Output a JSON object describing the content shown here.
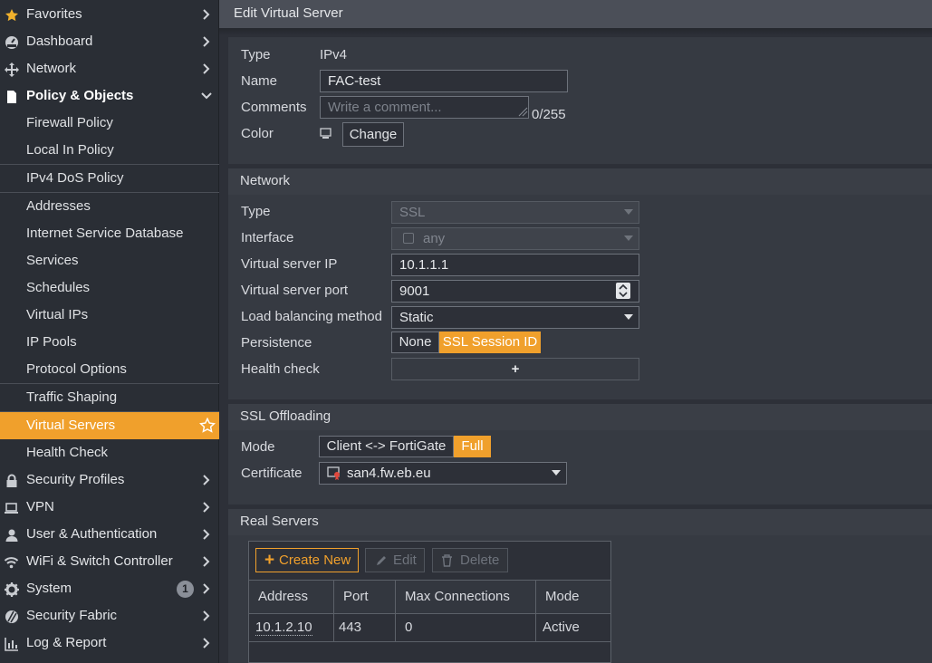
{
  "sidebar": {
    "favorites": "Favorites",
    "dashboard": "Dashboard",
    "network": "Network",
    "policy_objects": "Policy & Objects",
    "firewall_policy": "Firewall Policy",
    "local_in_policy": "Local In Policy",
    "ipv4_dos_policy": "IPv4 DoS Policy",
    "addresses": "Addresses",
    "internet_service_database": "Internet Service Database",
    "services": "Services",
    "schedules": "Schedules",
    "virtual_ips": "Virtual IPs",
    "ip_pools": "IP Pools",
    "protocol_options": "Protocol Options",
    "traffic_shaping": "Traffic Shaping",
    "virtual_servers": "Virtual Servers",
    "health_check": "Health Check",
    "security_profiles": "Security Profiles",
    "vpn": "VPN",
    "user_authentication": "User & Authentication",
    "wifi_switch": "WiFi & Switch Controller",
    "system": "System",
    "system_badge": "1",
    "security_fabric": "Security Fabric",
    "log_report": "Log & Report"
  },
  "page": {
    "title": "Edit Virtual Server"
  },
  "general": {
    "type_label": "Type",
    "type_value": "IPv4",
    "name_label": "Name",
    "name_value": "FAC-test",
    "comments_label": "Comments",
    "comments_placeholder": "Write a comment...",
    "comments_counter": "0/255",
    "color_label": "Color",
    "change_button": "Change"
  },
  "network_section": {
    "heading": "Network",
    "type_label": "Type",
    "type_value": "SSL",
    "interface_label": "Interface",
    "interface_value": "any",
    "vs_ip_label": "Virtual server IP",
    "vs_ip_value": "10.1.1.1",
    "vs_port_label": "Virtual server port",
    "vs_port_value": "9001",
    "lb_label": "Load balancing method",
    "lb_value": "Static",
    "persistence_label": "Persistence",
    "persistence_none": "None",
    "persistence_ssl": "SSL Session ID",
    "health_label": "Health check",
    "health_add": "+"
  },
  "ssl_section": {
    "heading": "SSL Offloading",
    "mode_label": "Mode",
    "mode_client": "Client <-> FortiGate",
    "mode_full": "Full",
    "cert_label": "Certificate",
    "cert_value": "san4.fw.eb.eu"
  },
  "real_servers": {
    "heading": "Real Servers",
    "create_new": "Create New",
    "edit": "Edit",
    "delete": "Delete",
    "columns": [
      "Address",
      "Port",
      "Max Connections",
      "Mode"
    ],
    "rows": [
      {
        "address": "10.1.2.10",
        "port": "443",
        "max_connections": "0",
        "mode": "Active"
      }
    ]
  },
  "colors": {
    "accent": "#f0a02c",
    "sidebar_bg": "#2a2e35",
    "panel_bg": "#2d3038"
  }
}
